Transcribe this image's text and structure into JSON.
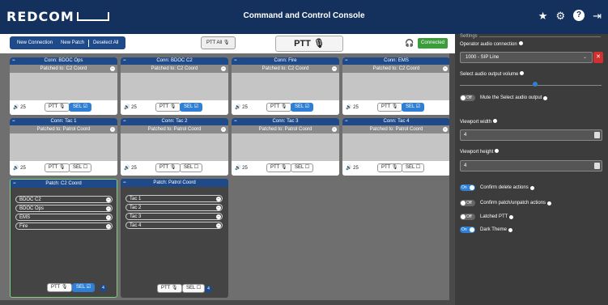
{
  "header": {
    "logo": "REDCOM",
    "title": "Command and Control Console"
  },
  "toolbar": {
    "new_connection": "New Connection",
    "new_patch": "New Patch",
    "deselect_all": "Deselect All",
    "ptt_all": "PTT All",
    "ptt_big": "PTT",
    "status": "Connected"
  },
  "connections": [
    {
      "name": "Conn: BDOC Ops",
      "patched": "Patched to: C2 Coord",
      "volume": "25",
      "ptt": "PTT",
      "sel": "SEL",
      "selected": true
    },
    {
      "name": "Conn: BDOC C2",
      "patched": "Patched to: C2 Coord",
      "volume": "25",
      "ptt": "PTT",
      "sel": "SEL",
      "selected": true
    },
    {
      "name": "Conn: Fire",
      "patched": "Patched to: C2 Coord",
      "volume": "25",
      "ptt": "PTT",
      "sel": "SEL",
      "selected": true
    },
    {
      "name": "Conn: EMS",
      "patched": "Patched to: C2 Coord",
      "volume": "25",
      "ptt": "PTT",
      "sel": "SEL",
      "selected": true
    },
    {
      "name": "Conn: Tac 1",
      "patched": "Patched to: Patrol Coord",
      "volume": "25",
      "ptt": "PTT",
      "sel": "SEL",
      "selected": false
    },
    {
      "name": "Conn: Tac 2",
      "patched": "Patched to: Patrol Coord",
      "volume": "25",
      "ptt": "PTT",
      "sel": "SEL",
      "selected": false
    },
    {
      "name": "Conn: Tac 3",
      "patched": "Patched to: Patrol Coord",
      "volume": "25",
      "ptt": "PTT",
      "sel": "SEL",
      "selected": false
    },
    {
      "name": "Conn: Tac 4",
      "patched": "Patched to: Patrol Coord",
      "volume": "25",
      "ptt": "PTT",
      "sel": "SEL",
      "selected": false
    }
  ],
  "patches": [
    {
      "name": "Patch: C2 Coord",
      "members": [
        "BDOC C2",
        "BDOC Ops",
        "EMS",
        "Fire"
      ],
      "ptt": "PTT",
      "sel": "SEL",
      "count": "4",
      "selected": true
    },
    {
      "name": "Patch: Patrol Coord",
      "members": [
        "Tac 1",
        "Tac 2",
        "Tac 3",
        "Tac 4"
      ],
      "ptt": "PTT",
      "sel": "SEL",
      "count": "4",
      "selected": false
    }
  ],
  "settings": {
    "legend": "Settings",
    "audio_connection_label": "Operator audio connection",
    "audio_connection_value": "1000 - SIP Line",
    "volume_label": "Select audio output volume",
    "volume_fraction": 0.53,
    "mute_label": "Mute the Select audio output",
    "mute_state": "Off",
    "width_label": "Viewport width",
    "width_value": "4",
    "height_label": "Viewport height",
    "height_value": "4",
    "confirm_delete_label": "Confirm delete actions",
    "confirm_delete_state": "On",
    "confirm_patch_label": "Confirm patch/unpatch actions",
    "confirm_patch_state": "Off",
    "latched_ptt_label": "Latched PTT",
    "latched_ptt_state": "Off",
    "dark_theme_label": "Dark Theme",
    "dark_theme_state": "On"
  },
  "colors": {
    "header": "#13315c",
    "accent": "#1f4a8a",
    "connected": "#3a9c3a",
    "delete": "#d32f2f",
    "selected": "#2f7fd5"
  }
}
